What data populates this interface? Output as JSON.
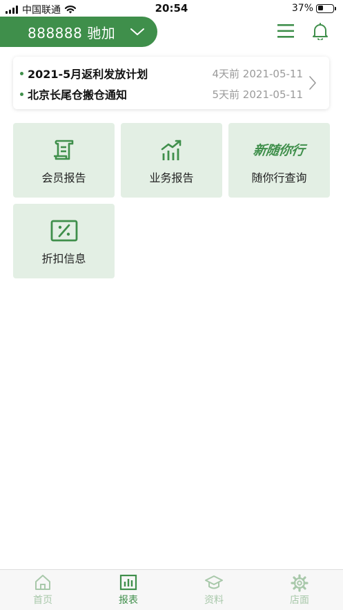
{
  "status_bar": {
    "carrier": "中国联通",
    "time": "20:54",
    "battery_percent_label": "37%",
    "battery_level": 0.37
  },
  "header": {
    "store_name": "888888 驰加"
  },
  "notices": [
    {
      "title": "2021-5月返利发放计划",
      "meta": "4天前 2021-05-11"
    },
    {
      "title": "北京长尾仓搬仓通知",
      "meta": "5天前 2021-05-11"
    }
  ],
  "tiles": [
    {
      "label": "会员报告",
      "icon": "scroll-icon"
    },
    {
      "label": "业务报告",
      "icon": "trend-chart-icon"
    },
    {
      "label": "随你行查询",
      "icon": "brand-logo",
      "logo_text": "新随你行"
    },
    {
      "label": "折扣信息",
      "icon": "discount-ticket-icon"
    }
  ],
  "tabbar": {
    "active": "reports",
    "items": [
      {
        "key": "home",
        "label": "首页",
        "icon": "home-icon"
      },
      {
        "key": "reports",
        "label": "报表",
        "icon": "bar-chart-icon"
      },
      {
        "key": "materials",
        "label": "资料",
        "icon": "graduation-cap-icon"
      },
      {
        "key": "store",
        "label": "店面",
        "icon": "gear-icon"
      }
    ]
  },
  "colors": {
    "accent": "#3f8f4b",
    "tile_bg": "#e3efe4",
    "muted_text": "#9a9a9a",
    "tab_inactive": "#a8c8aa"
  }
}
